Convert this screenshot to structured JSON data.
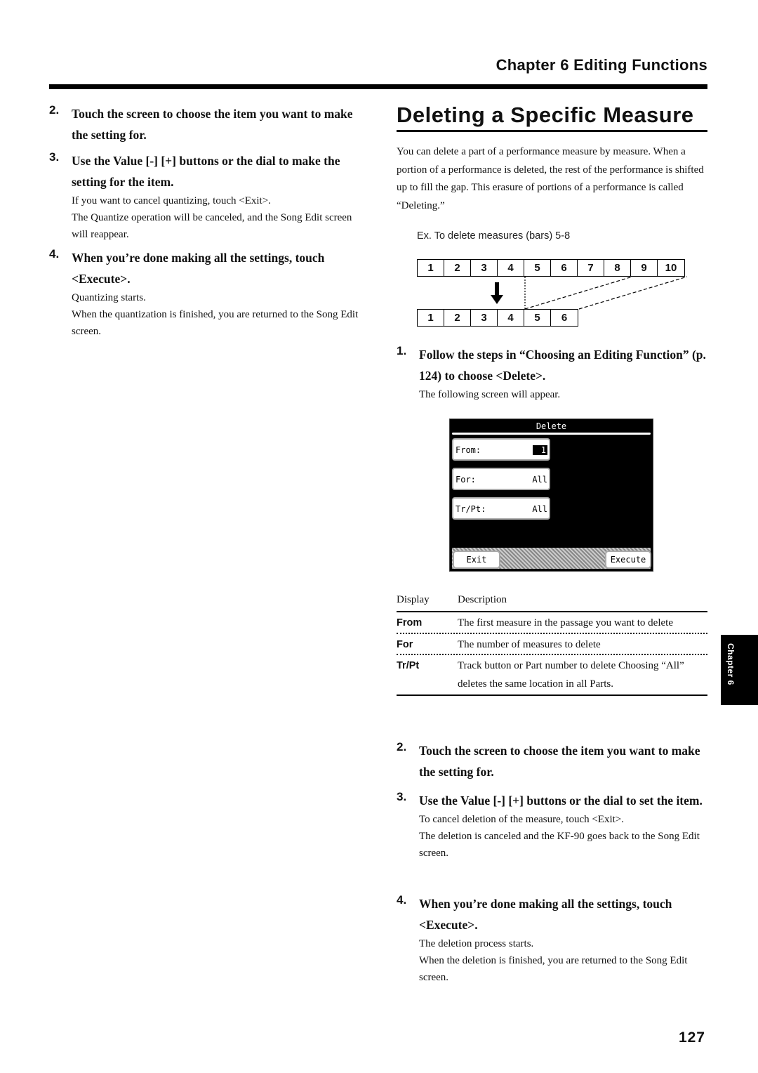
{
  "header": {
    "chapter_title": "Chapter 6 Editing Functions"
  },
  "left_column": {
    "steps": [
      {
        "num": "2.",
        "title": "Touch the screen to choose the item you want to make the setting for.",
        "body": []
      },
      {
        "num": "3.",
        "title": "Use the Value [-] [+] buttons or the dial to make the setting for the item.",
        "body": [
          "If you want to cancel quantizing, touch <Exit>.",
          "The Quantize operation will be canceled, and the Song Edit screen will reappear."
        ]
      },
      {
        "num": "4.",
        "title": "When you’re done making all the settings, touch <Execute>.",
        "body": [
          "Quantizing starts.",
          "When the quantization is finished, you are returned to the Song Edit screen."
        ]
      }
    ]
  },
  "section": {
    "title": "Deleting a Specific Measure",
    "intro": "You can delete a part of a performance measure by measure. When a portion of a performance is deleted, the rest of the performance is shifted up to fill the gap. This erasure of portions of a performance is called “Deleting.”",
    "example_label": "Ex. To delete measures (bars) 5-8",
    "diagram": {
      "before": [
        "1",
        "2",
        "3",
        "4",
        "5",
        "6",
        "7",
        "8",
        "9",
        "10"
      ],
      "after": [
        "1",
        "2",
        "3",
        "4",
        "5",
        "6"
      ],
      "arrow": "down-arrow"
    },
    "step1": {
      "num": "1.",
      "title": "Follow the steps in “Choosing an Editing Function” (p. 124) to choose <Delete>.",
      "body": "The following screen will appear."
    },
    "lcd": {
      "title": "Delete",
      "fields": [
        {
          "label": "From:",
          "value": "1"
        },
        {
          "label": "For:",
          "value": "All"
        },
        {
          "label": "Tr/Pt:",
          "value": "All"
        }
      ],
      "exit_label": "Exit",
      "execute_label": "Execute"
    },
    "table": {
      "headers": [
        "Display",
        "Description"
      ],
      "rows": [
        {
          "key": "From",
          "desc": "The first measure in the passage you want to delete"
        },
        {
          "key": "For",
          "desc": "The number of measures to delete"
        },
        {
          "key": "Tr/Pt",
          "desc": "Track button or Part number to delete Choosing “All” deletes the same location in all Parts."
        }
      ]
    },
    "steps": [
      {
        "num": "2.",
        "title": "Touch the screen to choose the item you want to make the setting for.",
        "body": []
      },
      {
        "num": "3.",
        "title": "Use the Value [-] [+] buttons or the dial to set the item.",
        "body": [
          "To cancel deletion of the measure, touch <Exit>.",
          "The deletion is canceled and the KF-90 goes back to the Song Edit screen."
        ]
      },
      {
        "num": "4.",
        "title": "When you’re done making all the settings, touch <Execute>.",
        "body": [
          "The deletion process starts.",
          "When the deletion is finished, you are returned to the Song Edit screen."
        ]
      }
    ]
  },
  "side_tab": {
    "label": "Chapter 6"
  },
  "footer": {
    "page_number": "127"
  }
}
